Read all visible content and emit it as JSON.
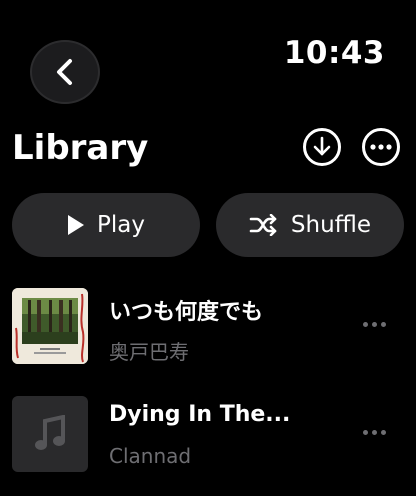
{
  "status": {
    "time": "10:43"
  },
  "header": {
    "title": "Library"
  },
  "actions": {
    "play_label": "Play",
    "shuffle_label": "Shuffle"
  },
  "songs": [
    {
      "title": "いつも何度でも",
      "artist": "奥戸巴寿",
      "art": "album-art-forest"
    },
    {
      "title": "Dying In The...",
      "artist": "Clannad",
      "art": "music-note-placeholder"
    }
  ],
  "icons": {
    "back": "chevron-left-icon",
    "download": "download-icon",
    "more": "ellipsis-icon",
    "play": "play-icon",
    "shuffle": "shuffle-icon"
  },
  "colors": {
    "background": "#000000",
    "pill": "#2a2a2c",
    "secondary_text": "#6e6e72"
  }
}
